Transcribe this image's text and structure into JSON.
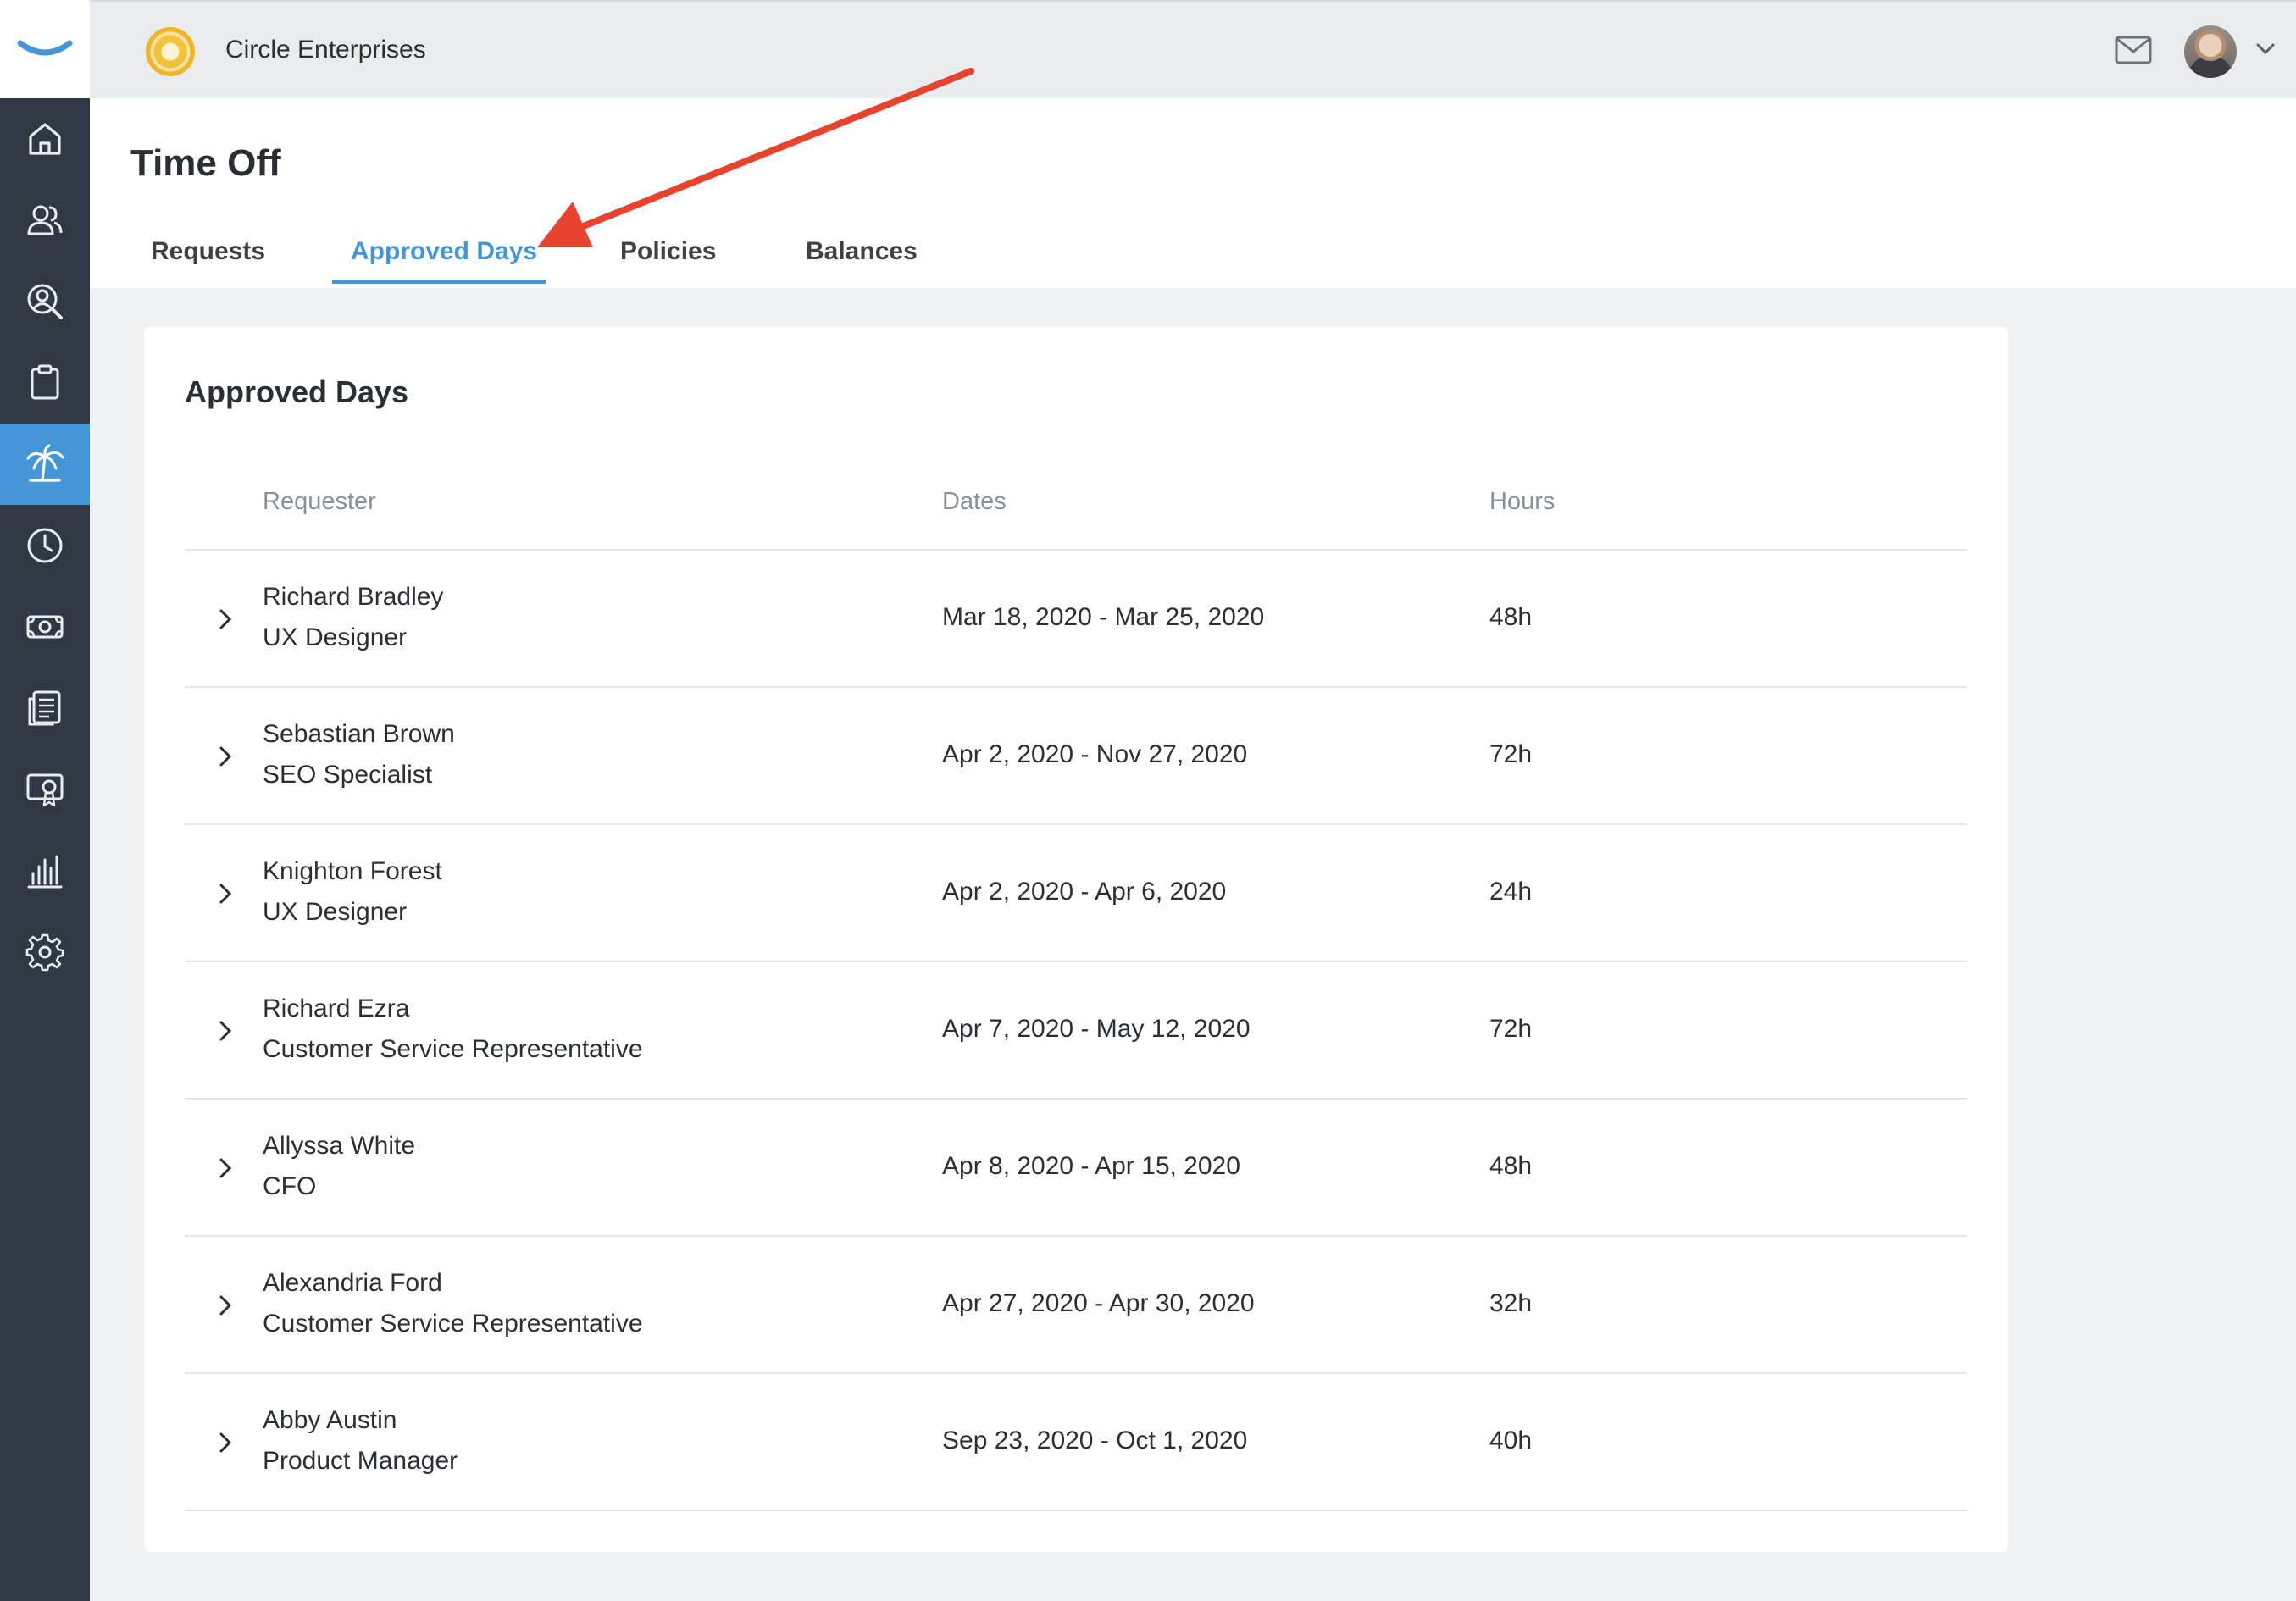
{
  "header": {
    "company_name": "Circle Enterprises"
  },
  "sidebar": {
    "items": [
      {
        "icon": "home-icon",
        "active": false
      },
      {
        "icon": "people-icon",
        "active": false
      },
      {
        "icon": "search-person-icon",
        "active": false
      },
      {
        "icon": "clipboard-icon",
        "active": false
      },
      {
        "icon": "palm-tree-icon",
        "active": true
      },
      {
        "icon": "clock-icon",
        "active": false
      },
      {
        "icon": "money-icon",
        "active": false
      },
      {
        "icon": "documents-icon",
        "active": false
      },
      {
        "icon": "certificate-icon",
        "active": false
      },
      {
        "icon": "bar-chart-icon",
        "active": false
      },
      {
        "icon": "gear-icon",
        "active": false
      }
    ]
  },
  "page": {
    "title": "Time Off",
    "tabs": [
      {
        "label": "Requests",
        "active": false
      },
      {
        "label": "Approved Days",
        "active": true
      },
      {
        "label": "Policies",
        "active": false
      },
      {
        "label": "Balances",
        "active": false
      }
    ]
  },
  "card": {
    "title": "Approved Days",
    "columns": [
      "Requester",
      "Dates",
      "Hours"
    ],
    "rows": [
      {
        "name": "Richard Bradley",
        "role": "UX Designer",
        "dates": "Mar 18, 2020 - Mar 25, 2020",
        "hours": "48h"
      },
      {
        "name": "Sebastian Brown",
        "role": "SEO Specialist",
        "dates": "Apr 2, 2020 - Nov 27, 2020",
        "hours": "72h"
      },
      {
        "name": "Knighton Forest",
        "role": "UX Designer",
        "dates": "Apr 2, 2020 - Apr 6, 2020",
        "hours": "24h"
      },
      {
        "name": "Richard Ezra",
        "role": "Customer Service Representative",
        "dates": "Apr 7, 2020 - May 12, 2020",
        "hours": "72h"
      },
      {
        "name": "Allyssa White",
        "role": "CFO",
        "dates": "Apr 8, 2020 - Apr 15, 2020",
        "hours": "48h"
      },
      {
        "name": "Alexandria Ford",
        "role": "Customer Service Representative",
        "dates": "Apr 27, 2020 - Apr 30, 2020",
        "hours": "32h"
      },
      {
        "name": "Abby Austin",
        "role": "Product Manager",
        "dates": "Sep 23, 2020 - Oct 1, 2020",
        "hours": "40h"
      }
    ]
  },
  "colors": {
    "accent": "#4596d9",
    "sidebar": "#2e3943",
    "annotation_arrow": "#e8432e"
  }
}
